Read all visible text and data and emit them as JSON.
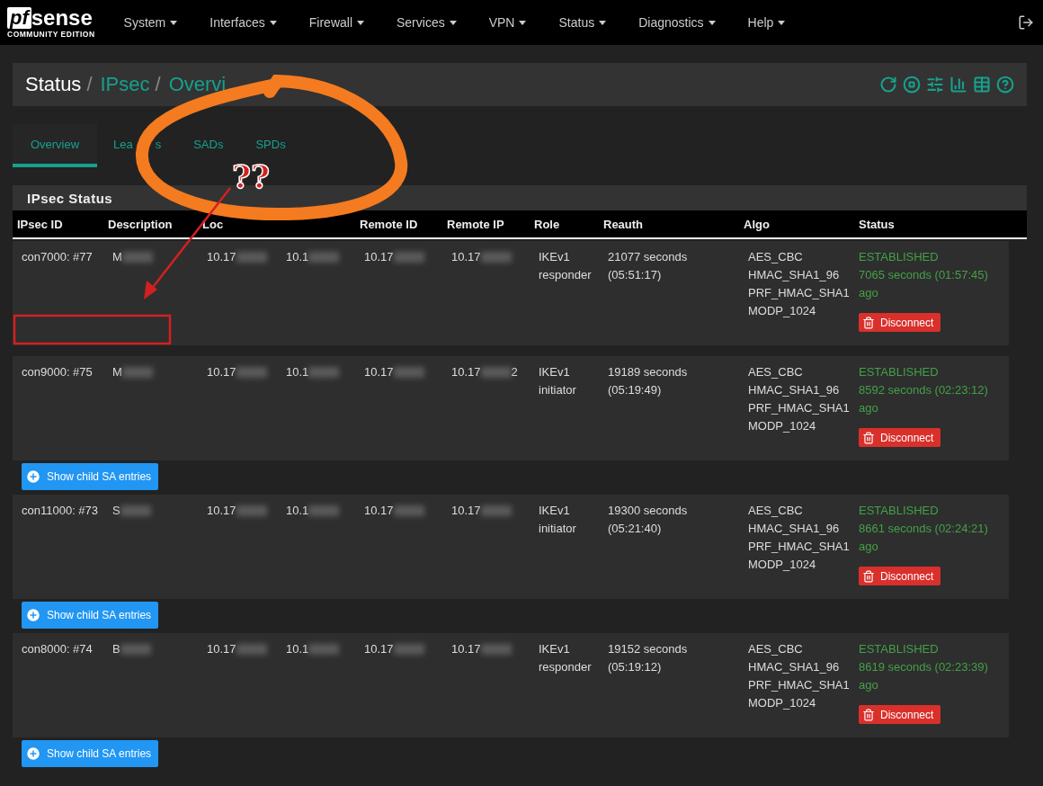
{
  "brand": {
    "mark": "pf",
    "name": "sense",
    "edition": "COMMUNITY EDITION"
  },
  "nav": [
    "System",
    "Interfaces",
    "Firewall",
    "Services",
    "VPN",
    "Status",
    "Diagnostics",
    "Help"
  ],
  "breadcrumb": [
    {
      "label": "Status",
      "link": false
    },
    {
      "separator": "/",
      "label": "IPsec",
      "link": true
    },
    {
      "separator": "/",
      "label": "Overvi",
      "link": true
    }
  ],
  "tabs": [
    {
      "label": "Overview",
      "selected": true
    },
    {
      "label": "Lea",
      "label_tail": "s",
      "selected": false
    },
    {
      "label": "SADs",
      "selected": false
    },
    {
      "label": "SPDs",
      "selected": false
    }
  ],
  "panel": {
    "title": "IPsec Status",
    "columns": [
      {
        "label": "IPsec ID"
      },
      {
        "label": "Description"
      },
      {
        "label": "Loc"
      },
      {},
      {
        "label": "Remote ID"
      },
      {
        "label": "Remote IP"
      },
      {
        "label": "Role"
      },
      {
        "label": "Reauth"
      },
      {
        "label": "Algo"
      },
      {
        "label": "Status"
      }
    ],
    "rows": [
      {
        "id": "con7000: #77",
        "description": "M",
        "local_id": "10.17",
        "local_ip": "10.1",
        "remote_id": "10.17",
        "remote_ip": "10.17",
        "role": "IKEv1 responder",
        "reauth": "21077 seconds (05:51:17)",
        "algo": [
          "AES_CBC",
          "HMAC_SHA1_96",
          "PRF_HMAC_SHA1",
          "MODP_1024"
        ],
        "status": "ESTABLISHED",
        "since": "7065 seconds (01:57:45) ago",
        "action": "Disconnect"
      },
      {
        "id": "con9000: #75",
        "description": "M",
        "local_id": "10.17",
        "local_ip": "10.1",
        "remote_id": "10.17",
        "remote_ip": "10.17",
        "remote_ip_tail": "2",
        "role": "IKEv1 initiator",
        "reauth": "19189 seconds (05:19:49)",
        "algo": [
          "AES_CBC",
          "HMAC_SHA1_96",
          "PRF_HMAC_SHA1",
          "MODP_1024"
        ],
        "status": "ESTABLISHED",
        "since": "8592 seconds (02:23:12) ago",
        "action": "Disconnect",
        "child_button": "Show child SA entries"
      },
      {
        "id": "con11000: #73",
        "description": "S",
        "local_id": "10.17",
        "local_ip": "10.1",
        "remote_id": "10.17",
        "remote_ip": "10.17",
        "role": "IKEv1 initiator",
        "reauth": "19300 seconds (05:21:40)",
        "algo": [
          "AES_CBC",
          "HMAC_SHA1_96",
          "PRF_HMAC_SHA1",
          "MODP_1024"
        ],
        "status": "ESTABLISHED",
        "since": "8661 seconds (02:24:21) ago",
        "action": "Disconnect",
        "child_button": "Show child SA entries"
      },
      {
        "id": "con8000: #74",
        "description": "B",
        "local_id": "10.17",
        "local_ip": "10.1",
        "remote_id": "10.17",
        "remote_ip": "10.17",
        "role": "IKEv1 responder",
        "reauth": "19152 seconds (05:19:12)",
        "algo": [
          "AES_CBC",
          "HMAC_SHA1_96",
          "PRF_HMAC_SHA1",
          "MODP_1024"
        ],
        "status": "ESTABLISHED",
        "since": "8619 seconds (02:23:39) ago",
        "action": "Disconnect",
        "child_button": "Show child SA entries"
      }
    ]
  },
  "annotations": [
    {
      "kind": "ellipse"
    },
    {
      "kind": "arrow"
    },
    {
      "kind": "box"
    },
    {
      "kind": "text",
      "text": "??"
    }
  ]
}
